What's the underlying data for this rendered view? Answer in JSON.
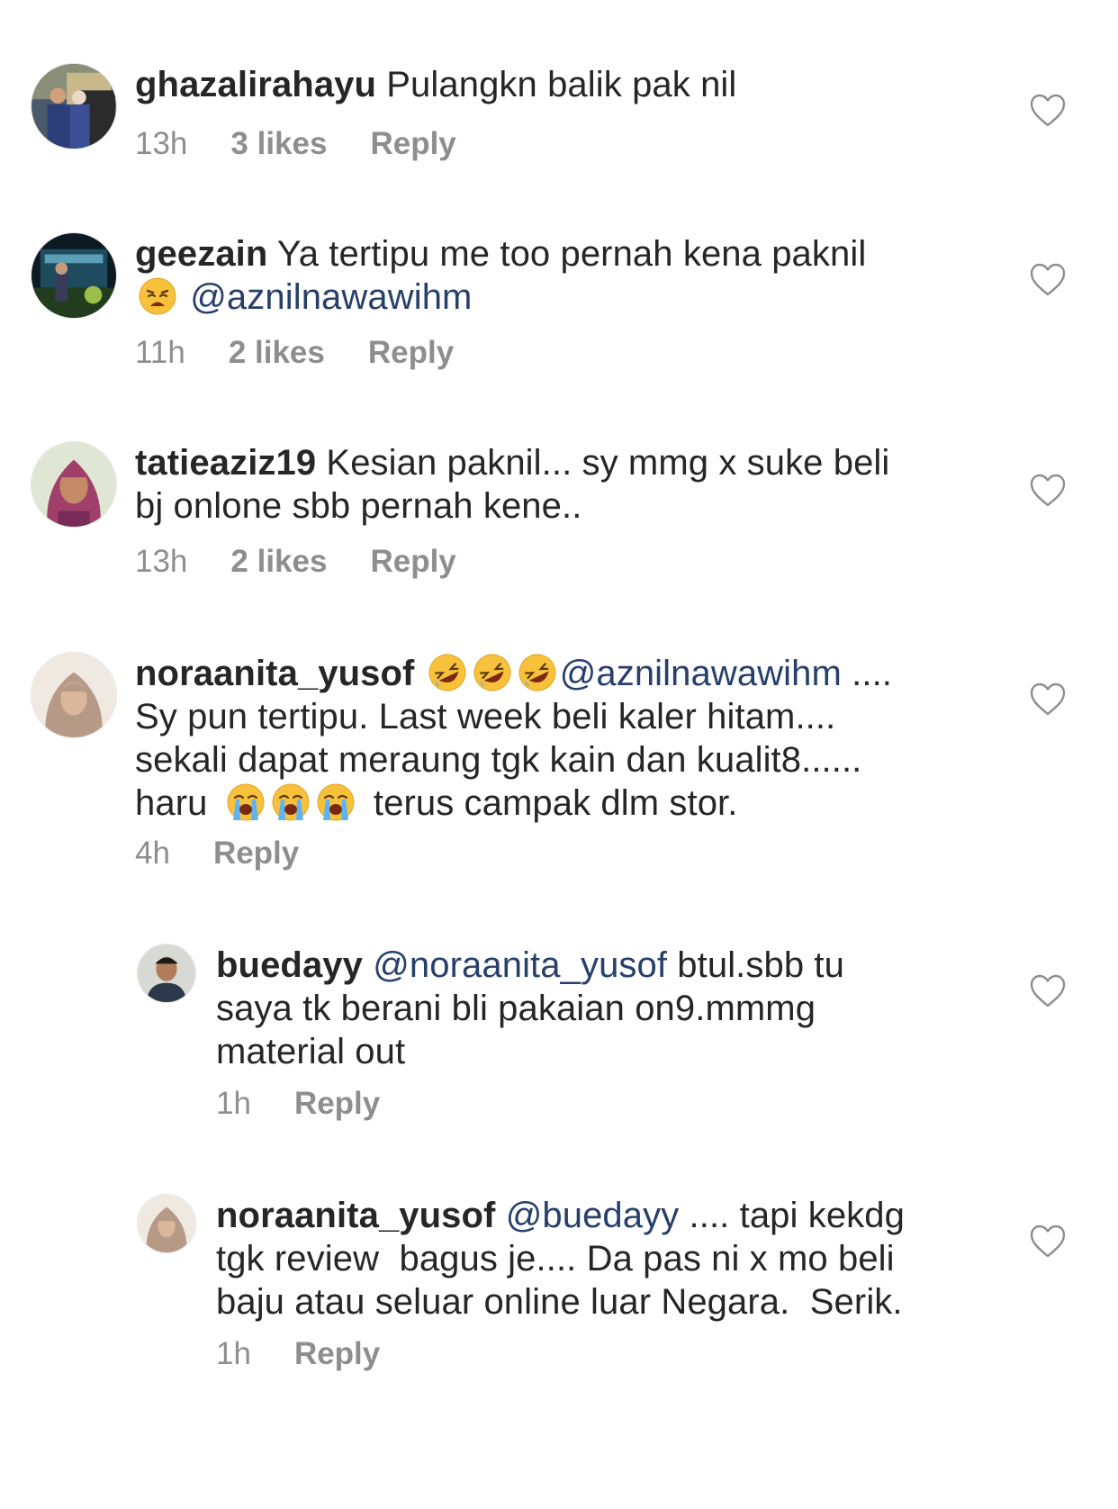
{
  "colors": {
    "text": "#262626",
    "muted": "#8e8e8e",
    "mention": "#27406b",
    "heart_outline": "#8e8e8e"
  },
  "comments": [
    {
      "username": "ghazalirahayu",
      "text": "Pulangkn balik pak nil",
      "time": "13h",
      "likes": "3 likes",
      "reply": "Reply"
    },
    {
      "username": "geezain",
      "text_line1": "Ya tertipu me too pernah kena paknil",
      "emoji": "weary-face",
      "mention": "@aznilnawawihm",
      "time": "11h",
      "likes": "2 likes",
      "reply": "Reply"
    },
    {
      "username": "tatieaziz19",
      "text_line1": "Kesian paknil... sy mmg x suke beli",
      "text_line2": "bj onlone sbb pernah kene..",
      "time": "13h",
      "likes": "2 likes",
      "reply": "Reply"
    },
    {
      "username": "noraanita_yusof",
      "emojis_1": "rolling-on-floor-laughing x3",
      "mention": "@aznilnawawihm",
      "text_tail": " ....",
      "text_line2": "Sy pun tertipu. Last week beli kaler hitam....",
      "text_line3": "sekali dapat meraung tgk kain dan kualit8......",
      "text_line4_a": "haru",
      "emojis_2": "loudly-crying-face x3",
      "text_line4_b": "terus campak dlm stor.",
      "time": "4h",
      "reply": "Reply"
    },
    {
      "username": "buedayy",
      "mention": "@noraanita_yusof",
      "text_line1_tail": " btul.sbb tu",
      "text_line2": "saya tk berani bli pakaian on9.mmmg",
      "text_line3": "material out",
      "time": "1h",
      "reply": "Reply"
    },
    {
      "username": "noraanita_yusof",
      "mention": "@buedayy",
      "text_line1_tail": " .... tapi kekdg",
      "text_line2": "tgk review  bagus je.... Da pas ni x mo beli",
      "text_line3": "baju atau seluar online luar Negara.  Serik.",
      "time": "1h",
      "reply": "Reply"
    }
  ],
  "icons": {
    "like": "heart-outline-icon",
    "emoji_weary": "weary-face-emoji",
    "emoji_rofl": "rolling-on-floor-laughing-emoji",
    "emoji_sob": "loudly-crying-face-emoji"
  }
}
